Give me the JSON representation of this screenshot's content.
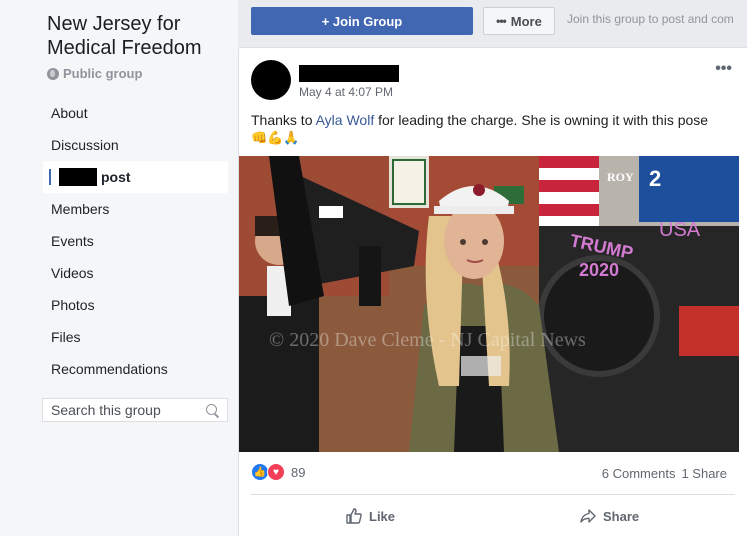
{
  "group": {
    "title": "New Jersey for Medical Freedom",
    "privacy": "Public group"
  },
  "nav": {
    "items": [
      {
        "label": "About"
      },
      {
        "label": "Discussion"
      },
      {
        "label": "post",
        "active": true
      },
      {
        "label": "Members"
      },
      {
        "label": "Events"
      },
      {
        "label": "Videos"
      },
      {
        "label": "Photos"
      },
      {
        "label": "Files"
      },
      {
        "label": "Recommendations"
      }
    ]
  },
  "search": {
    "placeholder": "Search this group"
  },
  "toolbar": {
    "join_label": "+ Join Group",
    "more_label": "More",
    "join_hint": "Join this group to post and com"
  },
  "post": {
    "timestamp": "May 4 at 4:07 PM",
    "text_before": "Thanks to ",
    "mention": "Ayla Wolf",
    "text_after": " for leading the charge. She is owning it with this pose",
    "emojis": "👊💪🙏",
    "photo_watermark": "© 2020 Dave Cleme - NJ Capital News",
    "photo_sign": "ROY",
    "reaction_count": "89",
    "comments": "6 Comments",
    "shares": "1 Share",
    "like_label": "Like",
    "share_label": "Share"
  },
  "colors": {
    "brand": "#4267b2",
    "link": "#385898",
    "like": "#2078f4",
    "love": "#f33e58"
  },
  "icons": [
    "globe-icon",
    "search-icon",
    "ellipsis-icon",
    "like-reaction-icon",
    "love-reaction-icon",
    "thumbs-up-icon",
    "share-arrow-icon"
  ]
}
